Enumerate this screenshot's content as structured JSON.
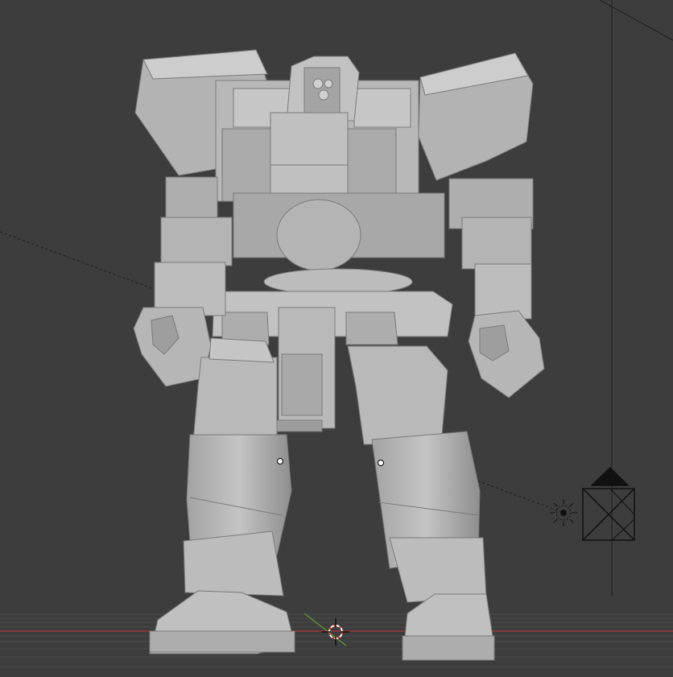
{
  "viewport": {
    "background": "#3d3d3d",
    "model_color": "#b9b9b9",
    "grid_color": "#4a4a4a",
    "x_axis_color": "#9a3636",
    "y_axis_color": "#5f9a3a",
    "overlay_color": "#111111"
  },
  "icons": {
    "camera": "camera-icon",
    "light": "light-icon",
    "cursor": "3d-cursor-icon"
  }
}
